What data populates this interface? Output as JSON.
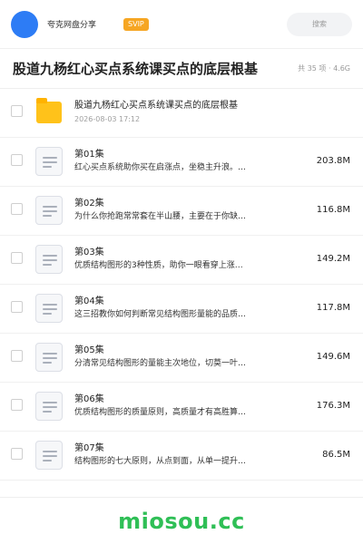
{
  "header": {
    "owner_name": "夸克网盘分享",
    "badge": "SVIP",
    "search_placeholder": "搜索"
  },
  "share": {
    "title": "股道九杨红心买点系统课买点的底层根基",
    "meta": "共 35 项 · 4.6G"
  },
  "folder": {
    "name": "股道九杨红心买点系统课买点的底层根基",
    "date": "2026-08-03 17:12"
  },
  "files": [
    {
      "name": "第01集",
      "desc": "红心买点系统助你买在启涨点，坐稳主升浪。…",
      "size": "203.8M"
    },
    {
      "name": "第02集",
      "desc": "为什么你抢跑常常套在半山腰，主要在于你缺…",
      "size": "116.8M"
    },
    {
      "name": "第03集",
      "desc": "优质结构图形的3种性质，助你一眼看穿上涨…",
      "size": "149.2M"
    },
    {
      "name": "第04集",
      "desc": "这三招教你如何判断常见结构图形量能的品质…",
      "size": "117.8M"
    },
    {
      "name": "第05集",
      "desc": "分清常见结构图形的量能主次地位，切莫一叶…",
      "size": "149.6M"
    },
    {
      "name": "第06集",
      "desc": "优质结构图形的质量原则，高质量才有高胜算…",
      "size": "176.3M"
    },
    {
      "name": "第07集",
      "desc": "结构图形的七大原则，从点到面，从单一提升…",
      "size": "86.5M"
    }
  ],
  "footer": {
    "watermark": "miosou.cc"
  },
  "colors": {
    "avatar": "#2d7cf5",
    "badge": "#f6a623",
    "folder": "#ffc21a",
    "watermark": "#2fbf56"
  }
}
